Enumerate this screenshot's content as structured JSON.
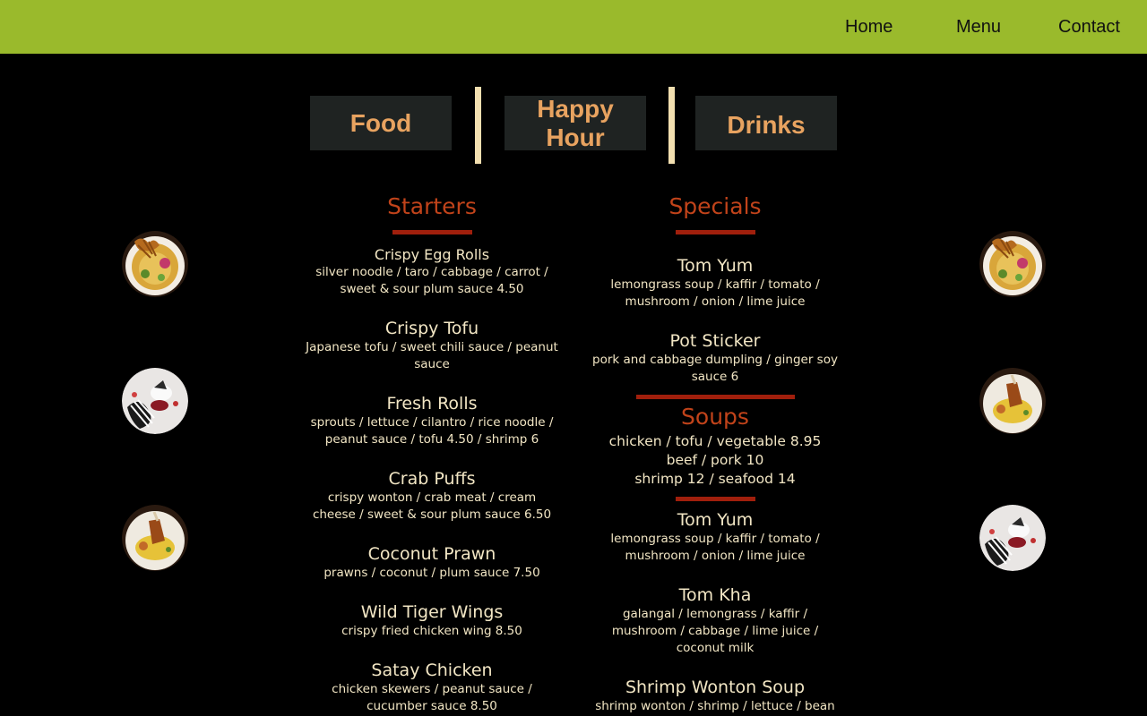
{
  "nav": {
    "home": "Home",
    "menu": "Menu",
    "contact": "Contact"
  },
  "tabs": {
    "food": "Food",
    "happy_line1": "Happy",
    "happy_line2": "Hour",
    "drinks": "Drinks"
  },
  "starters": {
    "heading": "Starters",
    "items": [
      {
        "name": "Crispy Egg Rolls",
        "desc1": "silver noodle / taro / cabbage / carrot /",
        "desc2": "sweet & sour plum sauce 4.50"
      },
      {
        "name": "Crispy Tofu",
        "desc1": "Japanese tofu / sweet chili sauce / peanut",
        "desc2": "sauce"
      },
      {
        "name": "Fresh Rolls",
        "desc1": "sprouts / lettuce / cilantro / rice noodle /",
        "desc2": "peanut sauce / tofu 4.50 / shrimp 6"
      },
      {
        "name": "Crab Puffs",
        "desc1": "crispy wonton / crab meat / cream",
        "desc2": "cheese / sweet & sour plum sauce 6.50"
      },
      {
        "name": "Coconut Prawn",
        "desc1": "prawns / coconut / plum sauce 7.50"
      },
      {
        "name": "Wild Tiger Wings",
        "desc1": "crispy fried chicken wing 8.50"
      },
      {
        "name": "Satay Chicken",
        "desc1": "chicken skewers / peanut sauce /",
        "desc2": "cucumber sauce 8.50"
      }
    ]
  },
  "specials": {
    "heading": "Specials",
    "items": [
      {
        "name": "Tom Yum",
        "desc1": "lemongrass soup / kaffir / tomato /",
        "desc2": "mushroom / onion / lime juice"
      },
      {
        "name": "Pot Sticker",
        "desc1": "pork and cabbage dumpling / ginger soy",
        "desc2": "sauce 6"
      }
    ]
  },
  "soups": {
    "heading": "Soups",
    "lines": [
      "chicken / tofu / vegetable 8.95",
      "beef / pork 10",
      "shrimp 12 / seafood 14"
    ],
    "items": [
      {
        "name": "Tom Yum",
        "desc1": "lemongrass soup / kaffir / tomato /",
        "desc2": "mushroom / onion / lime juice"
      },
      {
        "name": "Tom Kha",
        "desc1": "galangal / lemongrass / kaffir /",
        "desc2": "mushroom / cabbage / lime juice /",
        "desc3": "coconut milk"
      },
      {
        "name": "Shrimp Wonton Soup",
        "desc1": "shrimp wonton / shrimp / lettuce / bean"
      }
    ]
  },
  "colors": {
    "topbar": "#9aba2c",
    "tab_bg": "#1f2322",
    "tab_text": "#e8a360",
    "heading": "#c1431a",
    "rule": "#a01f0c",
    "text": "#f2e6c4"
  },
  "images": [
    "noodle-bowl-dish",
    "plated-dessert-dish",
    "fried-chicken-curry-dish"
  ]
}
